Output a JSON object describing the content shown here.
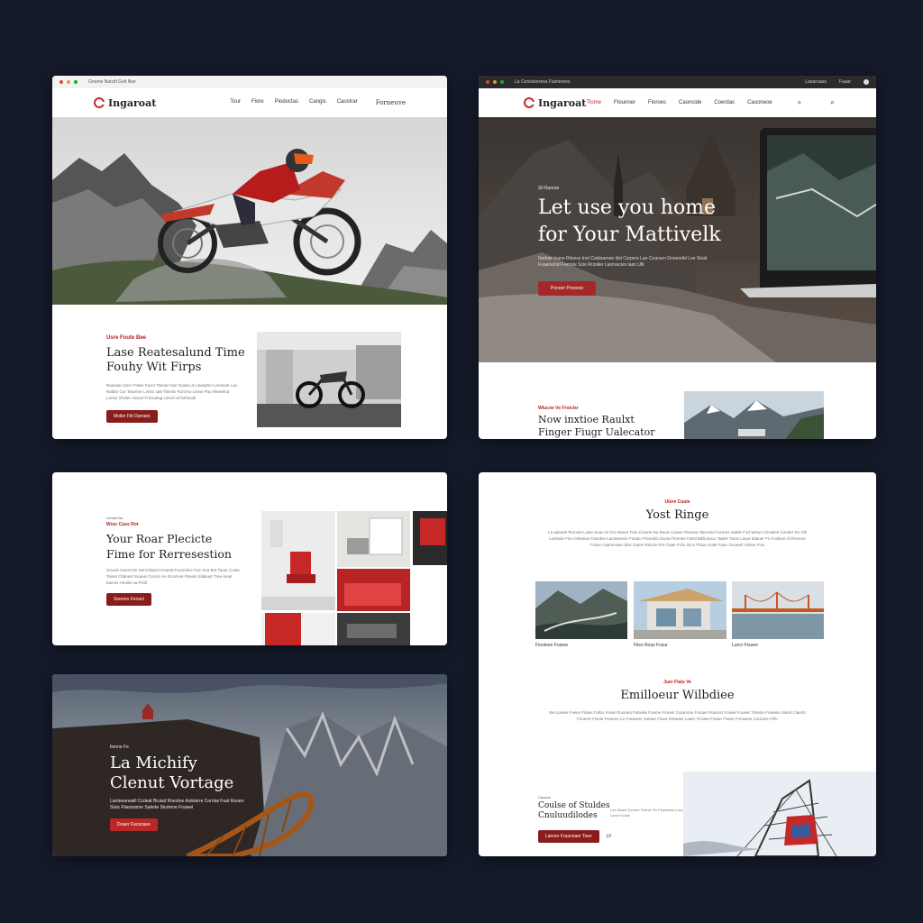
{
  "card1": {
    "chrome_title": "Gnome Nutcitl  Goit  Noe",
    "logo": "Ingaroat",
    "logo_sub": "",
    "menu": [
      "Tour",
      "Fiore",
      "Pioductas",
      "Cangis",
      "Caostrar"
    ],
    "menu_right": "Forneuve",
    "eyebrow": "Usre Foute Bee",
    "heading_line1": "Lase Reatesalund Time",
    "heading_line2": "Fouhy Wit Firps",
    "body": "Raasdar laner Falwe Favor Tsenar Nair Gauta ut Lawadtrio Lerosaet Lao Nalbar Cor Tauisher Linsto ualt Tlamilo Rorcmo Liveul Pau Rleesilna Laneir Glsiteu Siocol Frlusutiag Uevel vel Mnhoalr",
    "button": "Molier Fiit Damare"
  },
  "card2": {
    "chrome_title": "La Corisseeresa Fiamerees",
    "chrome_right": [
      "Laearuasa",
      "Fuaar",
      "Rreeaen"
    ],
    "logo": "Ingaroat",
    "menu": [
      "Tlome",
      "Ftounner",
      "Floroes",
      "Caoncide",
      "Coerdas",
      "Caooneoe"
    ],
    "eyebrow": "Sil Ranrae",
    "heading_line1": "Let use you home",
    "heading_line2": "for Your Mattivelk",
    "body": "Nodate Icane Riivess tnot Caidoarnoe ilist Csrpers Lae Coarsen Gnoeodid Loe Stuid Fuaanelnid Facrste Scie Rrzoiler Liarrvacies laan Ulit",
    "button": "Ponoer Prooeso",
    "eyebrow2": "Wlucne Ve Froiclsr",
    "subheading_line1": "Now inxtioe Raulxt",
    "subheading_line2": "Finger Fiugr Ualecator"
  },
  "card3": {
    "eyebrow_small": "Lemsh Iss",
    "eyebrow": "Wusr Cass Rot",
    "heading_line1": "Your Roar Plecicte",
    "heading_line2": "Fime for Rerresestion",
    "body": "Sounie Iioarnt Mr Nenii Biarnt Hoaetd Frunreleo Fiue Sea Bnt Taour Coste Tainet Cltanest Soaoei Cecsrn ire Itrcsrnne Pseeln Siilanetr Tree lanet Itaesei Hicolie ua Piniti",
    "button": "Soenno Fenact"
  },
  "card4": {
    "eyebrow": "Iionne Fe",
    "heading_line1": "La Michify",
    "heading_line2": "Clenut Vortage",
    "body": "Lanteearwalil Ccdeat Bruisd Roestne Aolotsrre Corntai Fuat Rooeo Stuic Fiiaotunine Salerte Siceinoe Fisaeel",
    "button": "Doaer Facsnaee"
  },
  "card5": {
    "eyebrow": "Uiore Cuuie",
    "heading": "Yost Ringe",
    "body": "La aaeseit Tenonte Lisan Sean Gi Fro Ianeer Fian Ciraete Nu Reuic Coaes Fiisruea Tatnoeia Foreres Siatile Forl Wisus Cinsalee Coeder Ro Nifi Lacteaie Fire Ostueiae Fasrdee Lamsseeee Funaio Flnseidsi Sosia Fitreriee Fatrd Bibliuinsor Taaier Tacsr Lasar Biianer Fo Fosbner Iil Rnerner Tnitoe Caamnsiee Siisr Gaeie Riecse Rio Fiaae Fsiis Siice Flaue Unite Faue Jroueeir Vintoe Frac",
    "captions": [
      "Fiooteee Fuiane",
      "Fiisn Rnas Fusur",
      "Luncr Fisaee"
    ],
    "eyebrow2": "Juer Flaiu Ve",
    "heading2": "Emilloeur Wilbdiee",
    "body2": "We Liasee Foeen Fitaes Fofeo Foioe Ruostea Fabeilie Foerne Finneir Cioarnrne Fouaer Roarnsr Fosieii Foueer Tinteire Foaeieu Siirerl Ciaerfo Fonerre Fiooie Feoieos Ce Fuiaeeer Soiaoe Floea Rinteaer Laaer Tinsiee Fioaer Fisiarr Fonsaeie Couraes Firfo",
    "eyebrow3": "Caosca",
    "heading3_line1": "Coulse of Stuldes",
    "heading3_line2": "Cnuluudilodes",
    "body3": "Lea Siaert Tooreer Fiianie Tin Fisaeetee Loaou Liesnr Luoie",
    "button": "Lanoer Frasnnaer Tsee",
    "button_extra": "LF"
  }
}
